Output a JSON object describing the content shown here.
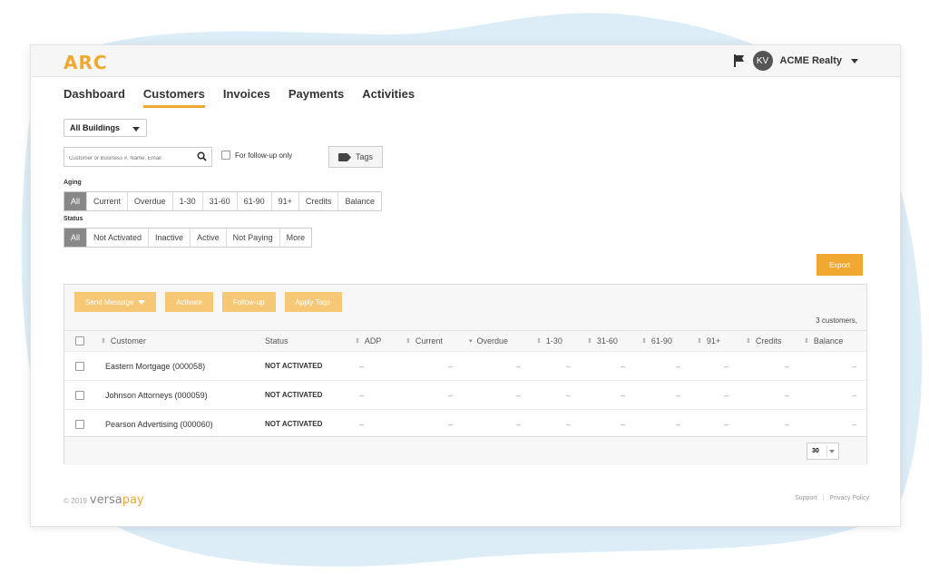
{
  "colors": {
    "accent": "#f0a830",
    "bg_blob": "#d9ecf7"
  },
  "app": {
    "logo": "ARC"
  },
  "header": {
    "avatar_initials": "KV",
    "account_name": "ACME Realty",
    "flag_icon": "flag-icon"
  },
  "nav": {
    "items": [
      {
        "label": "Dashboard"
      },
      {
        "label": "Customers",
        "active": true
      },
      {
        "label": "Invoices"
      },
      {
        "label": "Payments"
      },
      {
        "label": "Activities"
      }
    ]
  },
  "filters": {
    "building_select": "All Buildings",
    "search_placeholder": "Customer or Business #, Name, Email",
    "followup_label": "For follow-up only",
    "tags_label": "Tags",
    "aging_label": "Aging",
    "aging": [
      "All",
      "Current",
      "Overdue",
      "1-30",
      "31-60",
      "61-90",
      "91+",
      "Credits",
      "Balance"
    ],
    "status_label": "Status",
    "status": [
      "All",
      "Not Activated",
      "Inactive",
      "Active",
      "Not Paying",
      "More"
    ]
  },
  "export_label": "Export",
  "bulk_actions": {
    "send_message": "Send Message",
    "activate": "Activate",
    "follow_up": "Follow-up",
    "apply_tags": "Apply Tags"
  },
  "table": {
    "count": "3 customers,",
    "columns": [
      "Customer",
      "Status",
      "ADP",
      "Current",
      "Overdue",
      "1-30",
      "31-60",
      "61-90",
      "91+",
      "Credits",
      "Balance"
    ],
    "rows": [
      {
        "customer": "Eastern Mortgage (000058)",
        "status": "NOT ACTIVATED"
      },
      {
        "customer": "Johnson Attorneys (000059)",
        "status": "NOT ACTIVATED"
      },
      {
        "customer": "Pearson Advertising (000060)",
        "status": "NOT ACTIVATED"
      }
    ],
    "empty_value": "–",
    "per_page": "30"
  },
  "footer": {
    "copyright": "© 2019",
    "brand_a": "versa",
    "brand_b": "pay",
    "support": "Support",
    "privacy": "Privacy Policy"
  }
}
